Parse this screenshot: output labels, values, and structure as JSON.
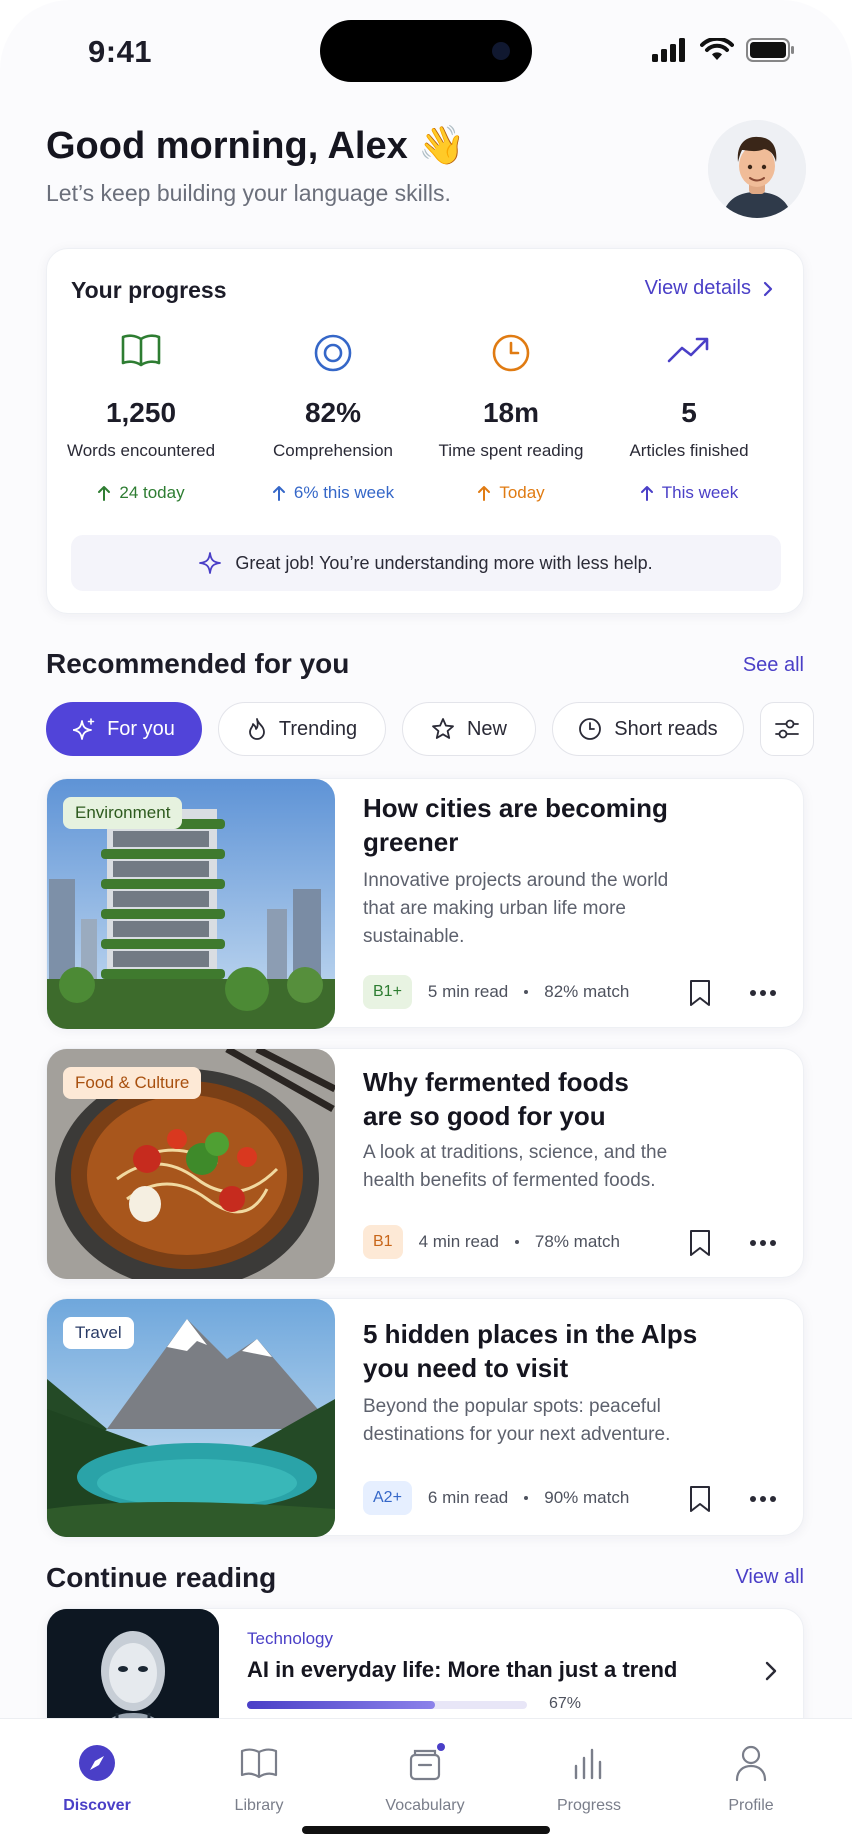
{
  "status": {
    "time": "9:41"
  },
  "greeting": {
    "title": "Good morning, Alex 👋",
    "subtitle": "Let’s keep building your language skills."
  },
  "progress": {
    "title": "Your progress",
    "link": "View details",
    "stats": [
      {
        "icon": "book-icon",
        "value": "1,250",
        "label": "Words encountered",
        "delta": "24 today",
        "color": "#2e7d32"
      },
      {
        "icon": "target-icon",
        "value": "82%",
        "label": "Comprehension",
        "delta": "6% this week",
        "color": "#3567c8"
      },
      {
        "icon": "clock-icon",
        "value": "18m",
        "label": "Time spent reading",
        "delta": "Today",
        "color": "#e07b12"
      },
      {
        "icon": "trend-icon",
        "value": "5",
        "label": "Articles finished",
        "delta": "This week",
        "color": "#4a3fc7"
      }
    ],
    "tip": "Great job! You’re understanding more with less help."
  },
  "recommended": {
    "title": "Recommended for you",
    "link": "See all",
    "chips": [
      {
        "label": "For you",
        "icon": "sparkle-icon",
        "active": true
      },
      {
        "label": "Trending",
        "icon": "flame-icon",
        "active": false
      },
      {
        "label": "New",
        "icon": "star-icon",
        "active": false
      },
      {
        "label": "Short reads",
        "icon": "clock-icon",
        "active": false
      }
    ],
    "articles": [
      {
        "tag": "Environment",
        "title": "How cities are becoming greener",
        "desc": "Innovative projects around the world that are making urban life more sustainable.",
        "level": "B1+",
        "read": "5 min read",
        "match": "82% match"
      },
      {
        "tag": "Food & Culture",
        "title": "Why fermented foods are so good for you",
        "desc": "A look at traditions, science, and the health benefits of fermented foods.",
        "level": "B1",
        "read": "4 min read",
        "match": "78% match"
      },
      {
        "tag": "Travel",
        "title": "5 hidden places in the Alps you need to visit",
        "desc": "Beyond the popular spots: peaceful destinations for your next adventure.",
        "level": "A2+",
        "read": "6 min read",
        "match": "90% match"
      }
    ]
  },
  "continue": {
    "title": "Continue reading",
    "link": "View all",
    "item": {
      "category": "Technology",
      "title": "AI in everyday life: More than just a trend",
      "progress_label": "67%",
      "progress": 0.67
    }
  },
  "tabs": [
    {
      "label": "Discover",
      "icon": "compass-icon",
      "active": true
    },
    {
      "label": "Library",
      "icon": "book-icon",
      "active": false
    },
    {
      "label": "Vocabulary",
      "icon": "cards-icon",
      "active": false
    },
    {
      "label": "Progress",
      "icon": "chart-icon",
      "active": false
    },
    {
      "label": "Profile",
      "icon": "person-icon",
      "active": false
    }
  ]
}
